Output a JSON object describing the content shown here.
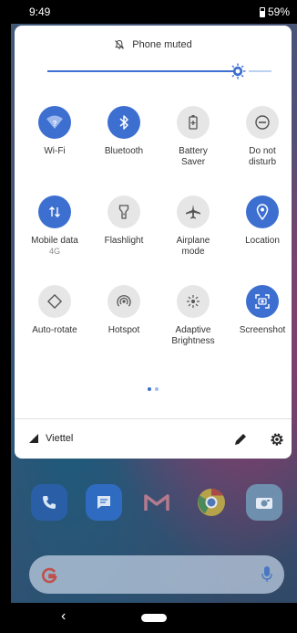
{
  "status_bar": {
    "time": "9:49",
    "battery": "59%"
  },
  "quick_settings": {
    "muted_text": "Phone muted",
    "brightness_level": 0.85,
    "tiles": [
      {
        "label": "Wi-Fi",
        "sub": "",
        "state": "on",
        "icon": "wifi-icon"
      },
      {
        "label": "Bluetooth",
        "sub": "",
        "state": "on",
        "icon": "bluetooth-icon"
      },
      {
        "label": "Battery\nSaver",
        "sub": "",
        "state": "off",
        "icon": "battery-saver-icon"
      },
      {
        "label": "Do not\ndisturb",
        "sub": "",
        "state": "off",
        "icon": "do-not-disturb-icon"
      },
      {
        "label": "Mobile data",
        "sub": "4G",
        "state": "on",
        "icon": "mobile-data-icon"
      },
      {
        "label": "Flashlight",
        "sub": "",
        "state": "off",
        "icon": "flashlight-icon"
      },
      {
        "label": "Airplane\nmode",
        "sub": "",
        "state": "off",
        "icon": "airplane-icon"
      },
      {
        "label": "Location",
        "sub": "",
        "state": "on",
        "icon": "location-icon"
      },
      {
        "label": "Auto-rotate",
        "sub": "",
        "state": "off",
        "icon": "auto-rotate-icon"
      },
      {
        "label": "Hotspot",
        "sub": "",
        "state": "off",
        "icon": "hotspot-icon"
      },
      {
        "label": "Adaptive\nBrightness",
        "sub": "",
        "state": "off",
        "icon": "adaptive-brightness-icon"
      },
      {
        "label": "Screenshot",
        "sub": "",
        "state": "on",
        "icon": "screenshot-icon"
      }
    ],
    "page_count": 2,
    "current_page": 1,
    "carrier": "Viettel"
  },
  "colors": {
    "accent": "#3d6fd1",
    "tile_off": "#e6e6e6",
    "panel_bg": "#ffffff"
  }
}
